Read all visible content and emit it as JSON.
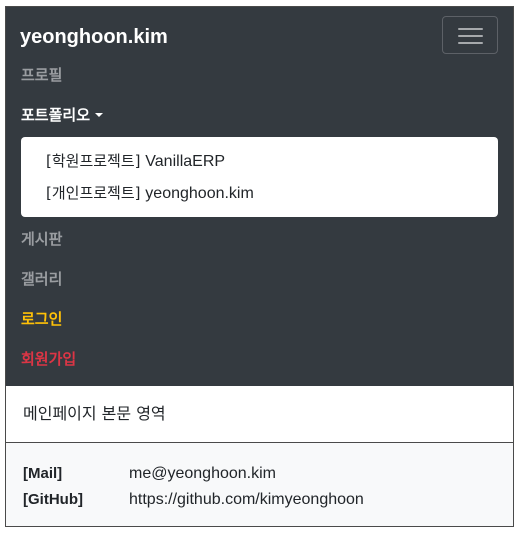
{
  "navbar": {
    "brand": "yeonghoon.kim",
    "toggler_icon": "hamburger-menu-icon",
    "items": [
      {
        "label": "프로필"
      },
      {
        "label": "포트폴리오"
      },
      {
        "label": "게시판"
      },
      {
        "label": "갤러리"
      },
      {
        "label": "로그인"
      },
      {
        "label": "회원가입"
      }
    ],
    "dropdown": [
      {
        "prefix": "[학원프로젝트]",
        "name": "VanillaERP"
      },
      {
        "prefix": "[개인프로젝트]",
        "name": "yeonghoon.kim"
      }
    ]
  },
  "main": {
    "text": "메인페이지 본문 영역"
  },
  "footer": {
    "mail_label": "[Mail]",
    "mail_value": "me@yeonghoon.kim",
    "github_label": "[GitHub]",
    "github_value": "https://github.com/kimyeonghoon"
  },
  "colors": {
    "navbar_bg": "#343a40",
    "login": "#ffc107",
    "signup": "#dc3545",
    "muted_link": "#9a9da1",
    "footer_bg": "#f8f9fa"
  }
}
